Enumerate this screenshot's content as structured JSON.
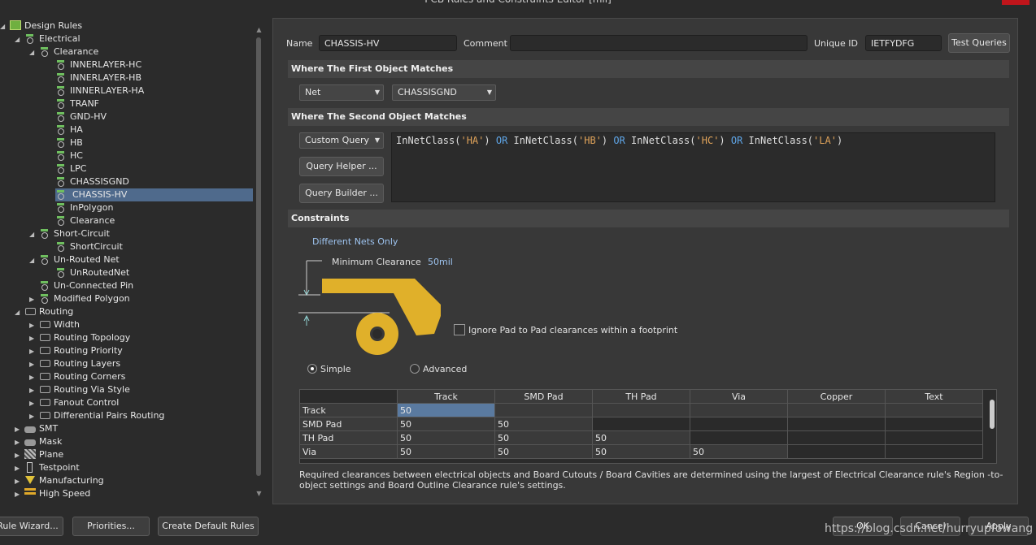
{
  "window": {
    "title": "PCB Rules and Constraints Editor [mil]"
  },
  "tree": {
    "nodes": [
      {
        "label": "Design Rules"
      },
      {
        "label": "Electrical"
      },
      {
        "label": "Clearance"
      },
      {
        "label": "INNERLAYER-HC"
      },
      {
        "label": "INNERLAYER-HB"
      },
      {
        "label": "IINNERLAYER-HA"
      },
      {
        "label": "TRANF"
      },
      {
        "label": "GND-HV"
      },
      {
        "label": "HA"
      },
      {
        "label": "HB"
      },
      {
        "label": "HC"
      },
      {
        "label": "LPC"
      },
      {
        "label": "CHASSISGND"
      },
      {
        "label": "CHASSIS-HV"
      },
      {
        "label": "InPolygon"
      },
      {
        "label": "Clearance"
      },
      {
        "label": "Short-Circuit"
      },
      {
        "label": "ShortCircuit"
      },
      {
        "label": "Un-Routed Net"
      },
      {
        "label": "UnRoutedNet"
      },
      {
        "label": "Un-Connected Pin"
      },
      {
        "label": "Modified Polygon"
      },
      {
        "label": "Routing"
      },
      {
        "label": "Width"
      },
      {
        "label": "Routing Topology"
      },
      {
        "label": "Routing Priority"
      },
      {
        "label": "Routing Layers"
      },
      {
        "label": "Routing Corners"
      },
      {
        "label": "Routing Via Style"
      },
      {
        "label": "Fanout Control"
      },
      {
        "label": "Differential Pairs Routing"
      },
      {
        "label": "SMT"
      },
      {
        "label": "Mask"
      },
      {
        "label": "Plane"
      },
      {
        "label": "Testpoint"
      },
      {
        "label": "Manufacturing"
      },
      {
        "label": "High Speed"
      }
    ]
  },
  "rule": {
    "name_label": "Name",
    "name_value": "CHASSIS-HV",
    "comment_label": "Comment",
    "comment_value": "",
    "uid_label": "Unique ID",
    "uid_value": "IETFYDFG",
    "test_queries": "Test Queries"
  },
  "first": {
    "header": "Where The First Object Matches",
    "type": "Net",
    "value": "CHASSISGND"
  },
  "second": {
    "header": "Where The Second Object Matches",
    "type": "Custom Query",
    "helper": "Query Helper ...",
    "builder": "Query Builder ...",
    "query": {
      "t1": "InNetClass(",
      "s1": "'HA'",
      "t2": ") ",
      "k1": "OR",
      "t3": " InNetClass(",
      "s2": "'HB'",
      "t4": ") ",
      "k2": "OR",
      "t5": " InNetClass(",
      "s3": "'HC'",
      "t6": ") ",
      "k3": "OR",
      "t7": " InNetClass(",
      "s4": "'LA'",
      "t8": ")"
    }
  },
  "constraints": {
    "header": "Constraints",
    "nets": "Different Nets Only",
    "min_label": "Minimum Clearance",
    "min_value": "50mil",
    "ignore_pad": "Ignore Pad to Pad clearances within a footprint",
    "simple": "Simple",
    "advanced": "Advanced",
    "columns": [
      "Track",
      "SMD Pad",
      "TH Pad",
      "Via",
      "Copper",
      "Text"
    ],
    "rows": [
      {
        "label": "Track",
        "values": [
          "50"
        ]
      },
      {
        "label": "SMD Pad",
        "values": [
          "50",
          "50"
        ]
      },
      {
        "label": "TH Pad",
        "values": [
          "50",
          "50",
          "50"
        ]
      },
      {
        "label": "Via",
        "values": [
          "50",
          "50",
          "50",
          "50"
        ]
      }
    ],
    "note": "Required clearances between electrical objects and Board Cutouts / Board Cavities are determined using the largest of Electrical Clearance rule's Region -to- object settings and Board Outline Clearance rule's settings."
  },
  "buttons": {
    "wizard": "Rule Wizard...",
    "priorities": "Priorities...",
    "defaults": "Create Default Rules",
    "ok": "OK",
    "cancel": "Cancel",
    "apply": "Apply"
  },
  "watermark": "https://blog.csdn.net/hurryupfowang",
  "colors": {
    "accent": "#4f6a8c",
    "pad": "#e0b02a",
    "query_string": "#e0a35a",
    "query_keyword": "#5fa6e8"
  }
}
